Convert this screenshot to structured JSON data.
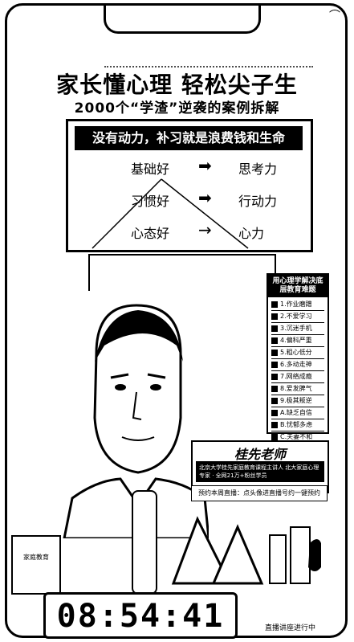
{
  "header": {
    "title": "家长懂心理 轻松尖子生",
    "subtitle": "2000个“学渣”逆袭的案例拆解"
  },
  "board": {
    "banner": "没有动力，补习就是浪费钱和生命",
    "rows": [
      {
        "left": "基础好",
        "right": "思考力"
      },
      {
        "left": "习惯好",
        "right": "行动力"
      },
      {
        "left": "心态好",
        "right": "心力"
      }
    ]
  },
  "sidecard": {
    "heading": "用心理学解决底层教育难题",
    "items": [
      "1.作业磨蹭",
      "2.不爱学习",
      "3.沉迷手机",
      "4.偏科严重",
      "5.粗心低分",
      "6.多动走神",
      "7.网络成瘾",
      "8.爱发脾气",
      "9.极其叛逆",
      "A.缺乏自信",
      "B.忧郁多虑",
      "C.夫妻不和"
    ]
  },
  "teacher": {
    "name": "桂先老师",
    "bio": "北京大学桂先家庭教育课程主讲人 北大家庭心理专家 · 全网21万+粉丝学员",
    "notice": "预约本周直播：点头像进直播号约一键预约"
  },
  "book": {
    "label": "家庭教育"
  },
  "clock": {
    "time": "08:54:41"
  },
  "plaque": {
    "text": "直播讲座进行中"
  }
}
